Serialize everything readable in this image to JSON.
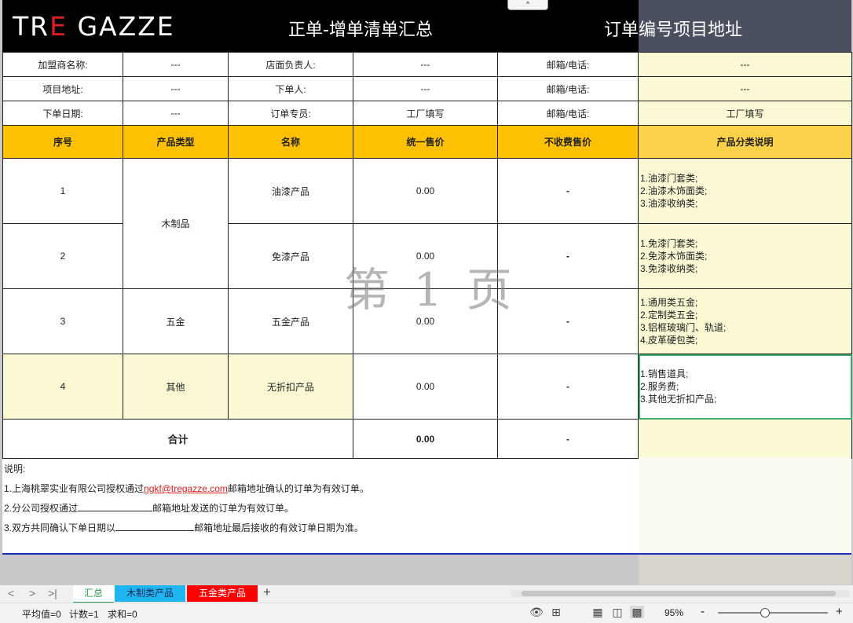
{
  "header": {
    "logo_left": "TR",
    "logo_red": "E",
    "logo_right": " GAZZE",
    "title": "正单-增单清单汇总",
    "subtitle": "订单编号项目地址",
    "collapse_icon": "^"
  },
  "info_rows": [
    {
      "l1": "加盟商名称:",
      "v1": "---",
      "l2": "店面负责人:",
      "v2": "---",
      "l3": "邮箱/电话:",
      "v3": "---"
    },
    {
      "l1": "项目地址:",
      "v1": "---",
      "l2": "下单人:",
      "v2": "---",
      "l3": "邮箱/电话:",
      "v3": "---"
    },
    {
      "l1": "下单日期:",
      "v1": "---",
      "l2": "订单专员:",
      "v2": "工厂填写",
      "l3": "邮箱/电话:",
      "v3": "工厂填写"
    }
  ],
  "columns": [
    "序号",
    "产品类型",
    "名称",
    "统一售价",
    "不收费售价",
    "产品分类说明"
  ],
  "rows": [
    {
      "no": "1",
      "name": "油漆产品",
      "price": "0.00",
      "free": "-",
      "desc": [
        "1.油漆门套类;",
        "2.油漆木饰面类;",
        "3.油漆收纳类;"
      ]
    },
    {
      "no": "2",
      "name": "免漆产品",
      "price": "0.00",
      "free": "-",
      "desc": [
        "1.免漆门套类;",
        "2.免漆木饰面类;",
        "3.免漆收纳类;"
      ]
    },
    {
      "no": "3",
      "type": "五金",
      "name": "五金产品",
      "price": "0.00",
      "free": "-",
      "desc": [
        "1.通用类五金;",
        "2.定制类五金;",
        "3.铝框玻璃门、轨道;",
        "4.皮革硬包类;"
      ]
    },
    {
      "no": "4",
      "type": "其他",
      "name": "无折扣产品",
      "price": "0.00",
      "free": "-",
      "desc": [
        "1.销售道具;",
        "2.服务费;",
        "3.其他无折扣产品;"
      ]
    }
  ],
  "wood_type": "木制品",
  "total": {
    "label": "合计",
    "price": "0.00",
    "free": "-"
  },
  "notes": {
    "title": "说明:",
    "n1_pre": "1.上海桃翠实业有限公司授权通过",
    "n1_email": "ngkf@tregazze.com",
    "n1_post": "邮箱地址确认的订单为有效订单。",
    "n2_pre": "2.分公司授权通过",
    "n2_post": "邮箱地址发送的订单为有效订单。",
    "n3_pre": "3.双方共同确认下单日期以",
    "n3_post": "邮箱地址最后接收的有效订单日期为准。"
  },
  "watermark": "第 1 页",
  "sheet_tabs": [
    {
      "label": "汇总",
      "bg": "#ffffff",
      "color": "#2a9d4a",
      "active": true
    },
    {
      "label": "木制类产品",
      "bg": "#1fb5f0",
      "color": "#1a2a5a",
      "active": false
    },
    {
      "label": "五金类产品",
      "bg": "#ff0000",
      "color": "#ffffff",
      "active": false
    }
  ],
  "tab_nav": {
    "prev": "<",
    "next": ">",
    "last": ">|",
    "add": "+"
  },
  "status": {
    "average": "平均值=0",
    "count": "计数=1",
    "sum": "求和=0",
    "zoom": "95%",
    "zoom_minus": "-",
    "zoom_plus": "+",
    "zoom_level": 0.42
  },
  "colors": {
    "header_bg": "#000000",
    "col_header": "#fec002",
    "cell_yellow": "#fbf8d4",
    "selection": "#3aaa6a",
    "note_email": "#e02020"
  }
}
